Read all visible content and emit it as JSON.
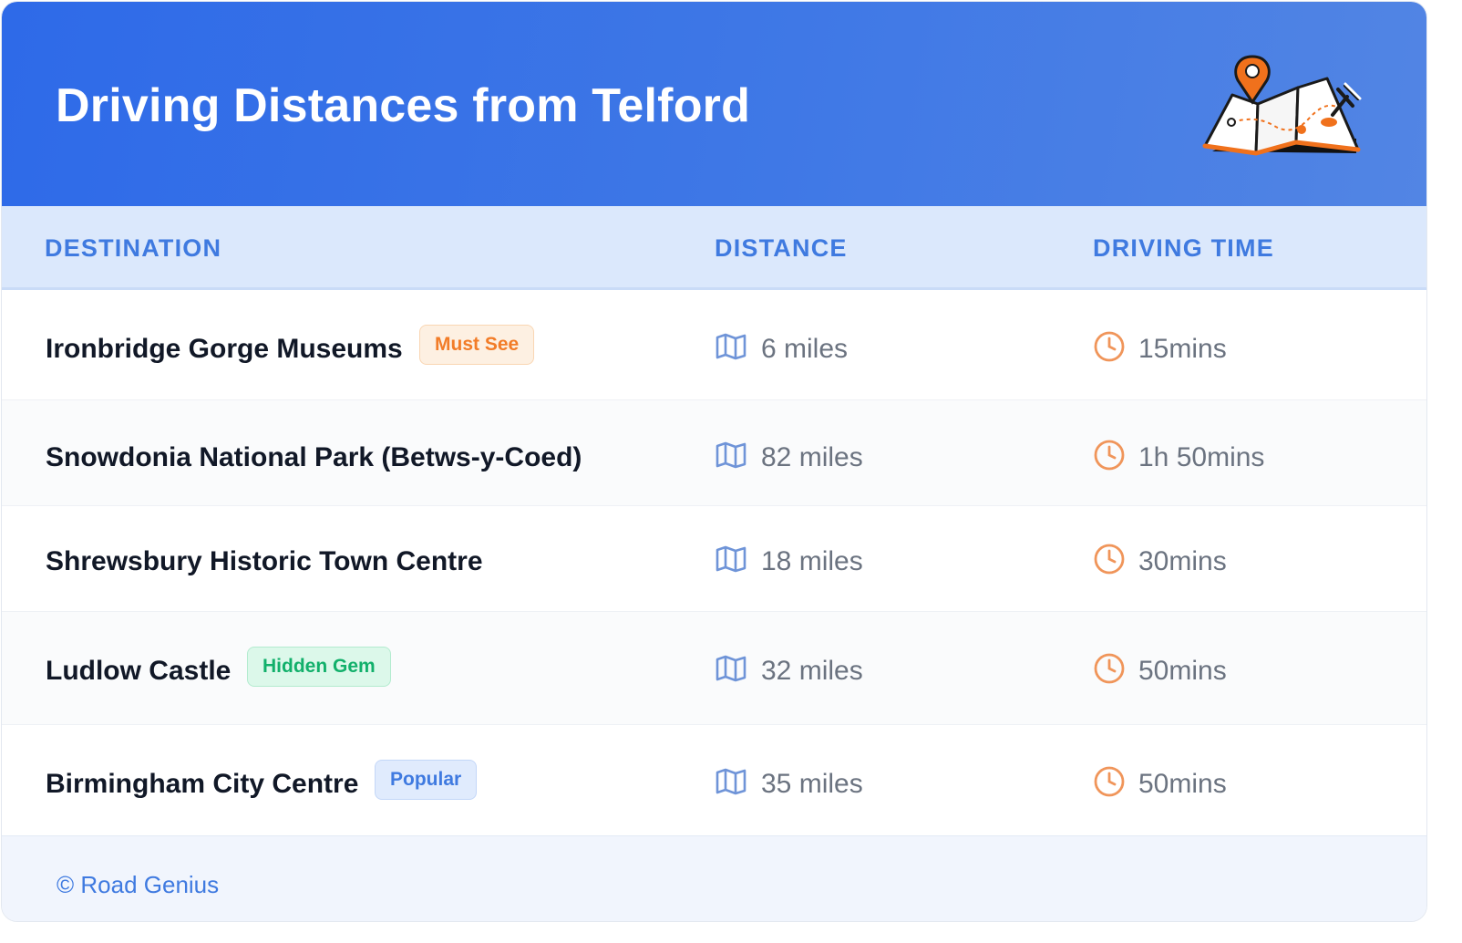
{
  "header": {
    "title": "Driving Distances from Telford",
    "illustration_icon": "folded-map-with-pins-icon",
    "background_color": "#3a72e6"
  },
  "table": {
    "columns": [
      "DESTINATION",
      "DISTANCE",
      "DRIVING TIME"
    ],
    "rows": [
      {
        "destination": "Ironbridge Gorge Museums",
        "badge": "Must See",
        "distance": "6 miles",
        "time": "15mins"
      },
      {
        "destination": "Snowdonia National Park (Betws-y-Coed)",
        "badge": null,
        "distance": "82 miles",
        "time": "1h 50mins"
      },
      {
        "destination": "Shrewsbury Historic Town Centre",
        "badge": null,
        "distance": "18 miles",
        "time": "30mins"
      },
      {
        "destination": "Ludlow Castle",
        "badge": "Hidden Gem",
        "distance": "32 miles",
        "time": "50mins"
      },
      {
        "destination": "Birmingham City Centre",
        "badge": "Popular",
        "distance": "35 miles",
        "time": "50mins"
      }
    ],
    "icons": {
      "distance": "map-icon",
      "time": "clock-icon"
    }
  },
  "footer": {
    "credit": "© Road Genius"
  },
  "colors": {
    "accent_blue": "#3f7ae0",
    "badge_orange": "#f27c28",
    "badge_green": "#12b06b",
    "clock_orange": "#f0955a"
  }
}
